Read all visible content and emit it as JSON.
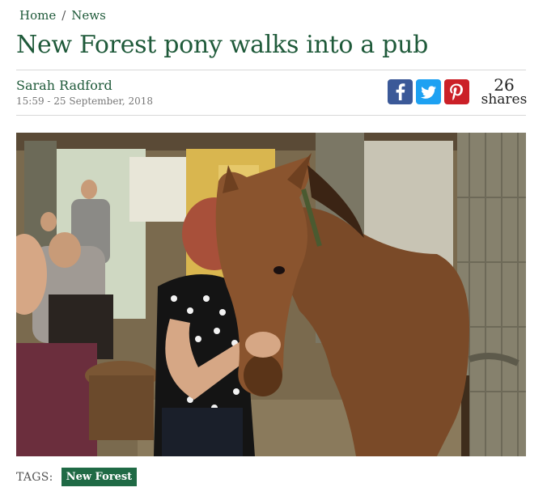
{
  "breadcrumb": {
    "home": "Home",
    "separator": "/",
    "current": "News"
  },
  "article": {
    "title": "New Forest pony walks into a pub",
    "author": "Sarah Radford",
    "date": "15:59 - 25 September, 2018"
  },
  "share": {
    "facebook_icon": "facebook-icon",
    "twitter_icon": "twitter-icon",
    "pinterest_icon": "pinterest-icon",
    "count": "26",
    "count_label": "shares"
  },
  "photo": {
    "subject": "pony-in-pub-photo"
  },
  "tags": {
    "label": "TAGS:",
    "items": [
      "New Forest"
    ]
  },
  "colors": {
    "brand_green": "#1f5a3a",
    "tag_green": "#1f6a45",
    "facebook": "#3b5998",
    "twitter": "#1da1f2",
    "pinterest": "#cb2027"
  }
}
